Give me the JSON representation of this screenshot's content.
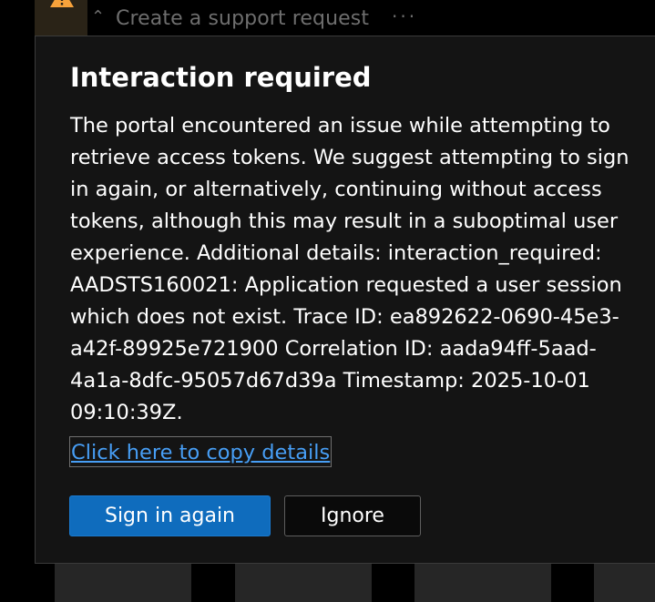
{
  "background": {
    "title": "Create a support request",
    "more_label": "···",
    "warning_color": "#f7a23b"
  },
  "dialog": {
    "title": "Interaction required",
    "message": "The portal encountered an issue while attempting to retrieve access tokens. We suggest attempting to sign in again, or alternatively, continuing without access tokens, although this may result in a suboptimal user experience. Additional details: interaction_required: AADSTS160021: Application requested a user session which does not exist. Trace ID: ea892622-0690-45e3-a42f-89925e721900 Correlation ID: aada94ff-5aad-4a1a-8dfc-95057d67d39a Timestamp: 2025-10-01 09:10:39Z.",
    "copy_link": "Click here to copy details",
    "primary_button": "Sign in again",
    "secondary_button": "Ignore"
  },
  "colors": {
    "dialog_bg": "#141414",
    "link": "#479ef5",
    "primary": "#0f6cbd"
  }
}
